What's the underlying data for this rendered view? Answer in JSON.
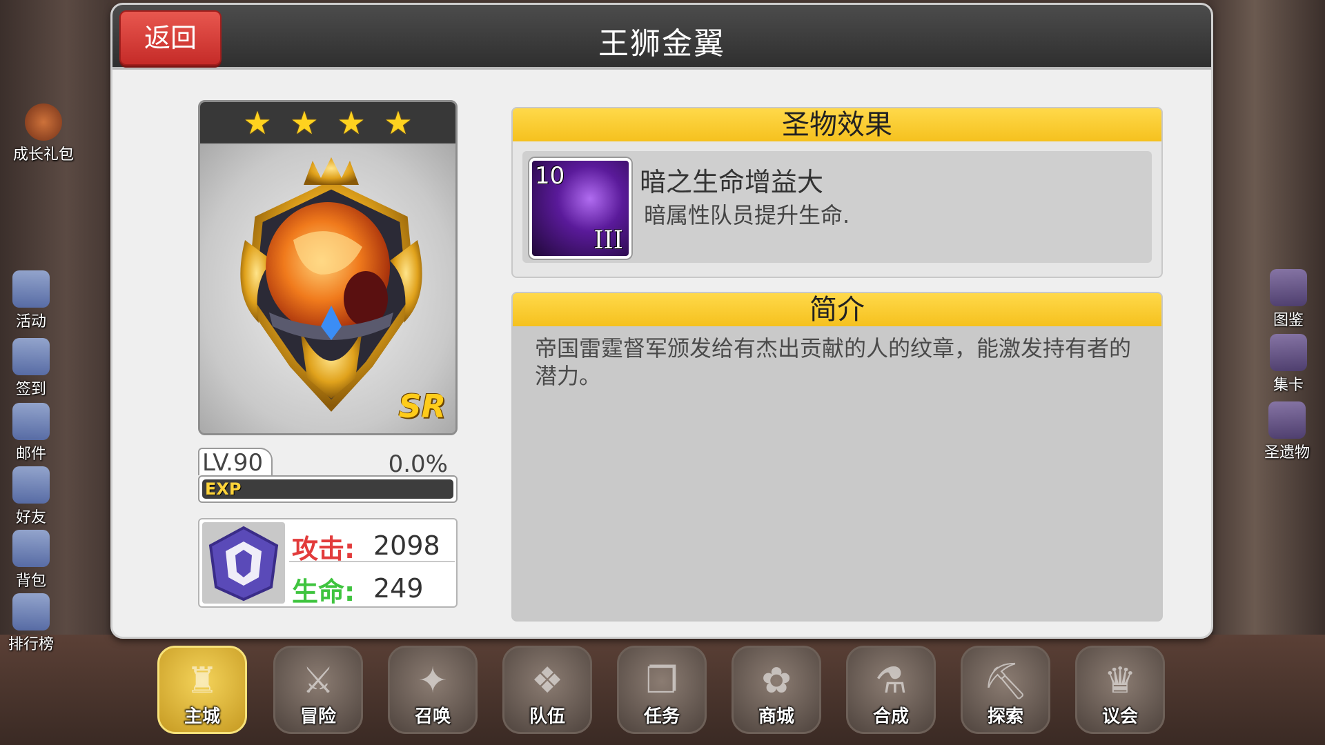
{
  "panel": {
    "title": "王狮金翼",
    "back_label": "返回"
  },
  "relic": {
    "stars": 4,
    "rarity": "SR",
    "level": "LV.90",
    "exp_percent_text": "0.0%",
    "exp_percent": 0,
    "exp_label": "EXP",
    "stats": {
      "attack_label": "攻击:",
      "attack_value": "2098",
      "hp_label": "生命:",
      "hp_value": "249"
    }
  },
  "effect": {
    "header": "圣物效果",
    "skill_level": "10",
    "skill_rank": "III",
    "name": "暗之生命增益大",
    "description": "暗属性队员提升生命."
  },
  "intro": {
    "header": "简介",
    "text": "帝国雷霆督军颁发给有杰出贡献的人的纹章，能激发持有者的潜力。"
  },
  "side_left": [
    {
      "label": "成长礼包",
      "icon": "gift-icon"
    },
    {
      "label": "活动",
      "icon": "megaphone-icon"
    },
    {
      "label": "签到",
      "icon": "checkin-icon"
    },
    {
      "label": "邮件",
      "icon": "mail-icon"
    },
    {
      "label": "好友",
      "icon": "friend-icon"
    },
    {
      "label": "背包",
      "icon": "bag-icon"
    },
    {
      "label": "排行榜",
      "icon": "ranking-icon"
    }
  ],
  "side_right": [
    {
      "label": "图鉴",
      "icon": "book-icon"
    },
    {
      "label": "集卡",
      "icon": "card-icon"
    },
    {
      "label": "圣遗物",
      "icon": "relic-icon"
    }
  ],
  "bottom_nav": [
    {
      "label": "主城",
      "icon": "castle-icon"
    },
    {
      "label": "冒险",
      "icon": "adventure-icon"
    },
    {
      "label": "召唤",
      "icon": "summon-icon"
    },
    {
      "label": "队伍",
      "icon": "team-icon"
    },
    {
      "label": "任务",
      "icon": "quest-icon"
    },
    {
      "label": "商城",
      "icon": "shop-icon"
    },
    {
      "label": "合成",
      "icon": "craft-icon"
    },
    {
      "label": "探索",
      "icon": "explore-icon"
    },
    {
      "label": "议会",
      "icon": "council-icon"
    }
  ],
  "colors": {
    "gold_header": "#f5c11e",
    "back_button": "#d9403b",
    "attack": "#e23b3b",
    "hp": "#3fc43f"
  }
}
